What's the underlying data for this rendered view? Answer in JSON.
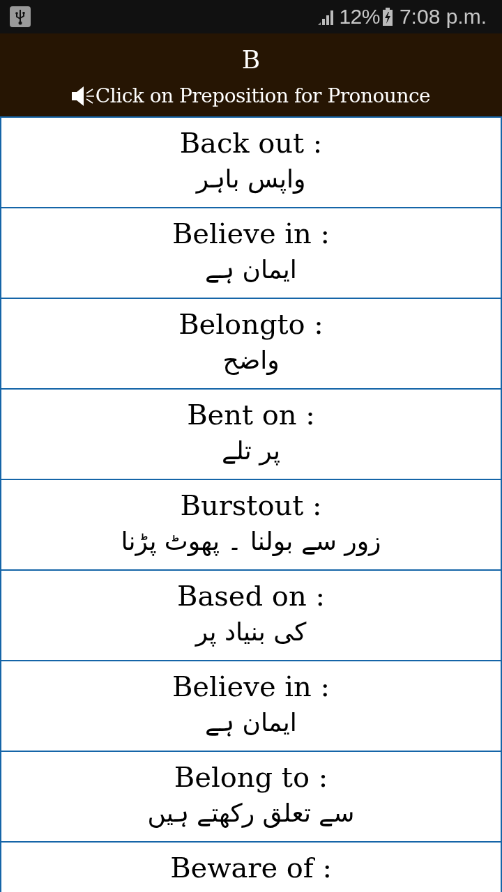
{
  "status_bar": {
    "battery": "12%",
    "time": "7:08 p.m."
  },
  "header": {
    "letter": "B",
    "hint": "Click on Preposition for Pronounce"
  },
  "prepositions": [
    {
      "phrase": "Back out :",
      "meaning": "واپس باہر"
    },
    {
      "phrase": "Believe in :",
      "meaning": "ایمان ہے"
    },
    {
      "phrase": "Belongto :",
      "meaning": "واضح"
    },
    {
      "phrase": "Bent on :",
      "meaning": "پر تلے"
    },
    {
      "phrase": "Burstout :",
      "meaning": "زور سے بولنا ۔ پھوٹ پڑنا"
    },
    {
      "phrase": "Based on :",
      "meaning": "کی بنیاد پر"
    },
    {
      "phrase": "Believe in :",
      "meaning": "ایمان ہے"
    },
    {
      "phrase": "Belong to :",
      "meaning": "سے تعلق رکھتے ہیں"
    },
    {
      "phrase": "Beware of :"
    }
  ]
}
